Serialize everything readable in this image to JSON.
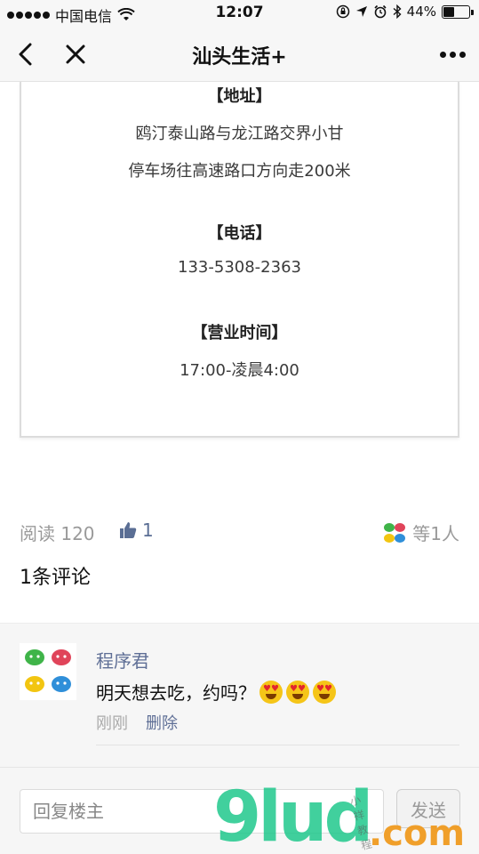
{
  "status_bar": {
    "carrier": "中国电信",
    "time": "12:07",
    "battery_percent": "44%",
    "battery_level": 0.44
  },
  "nav": {
    "title": "汕头生活+"
  },
  "article": {
    "address_heading": "【地址】",
    "address_line1": "鸥汀泰山路与龙江路交界小甘",
    "address_line2": "停车场往高速路口方向走200米",
    "phone_heading": "【电话】",
    "phone": "133-5308-2363",
    "hours_heading": "【营业时间】",
    "hours": "17:00-凌晨4:00"
  },
  "stats": {
    "read_label": "阅读 120",
    "like_count": "1",
    "likers_label": "等1人"
  },
  "comment_count": "1条评论",
  "comments": [
    {
      "name": "程序君",
      "text": "明天想去吃，约吗？",
      "emoji_count": 3,
      "time": "刚刚",
      "delete_label": "删除"
    }
  ],
  "reply": {
    "placeholder": "回复楼主",
    "send_label": "发送"
  },
  "watermark": {
    "main": "9lud",
    "domain": ".com",
    "small": "小祥 教程"
  },
  "colors": {
    "wechat_green": "#3fb449",
    "wechat_red": "#e0445a",
    "wechat_yellow": "#f2c511",
    "wechat_blue": "#2f8fd9",
    "link_blue": "#5f6f96"
  }
}
